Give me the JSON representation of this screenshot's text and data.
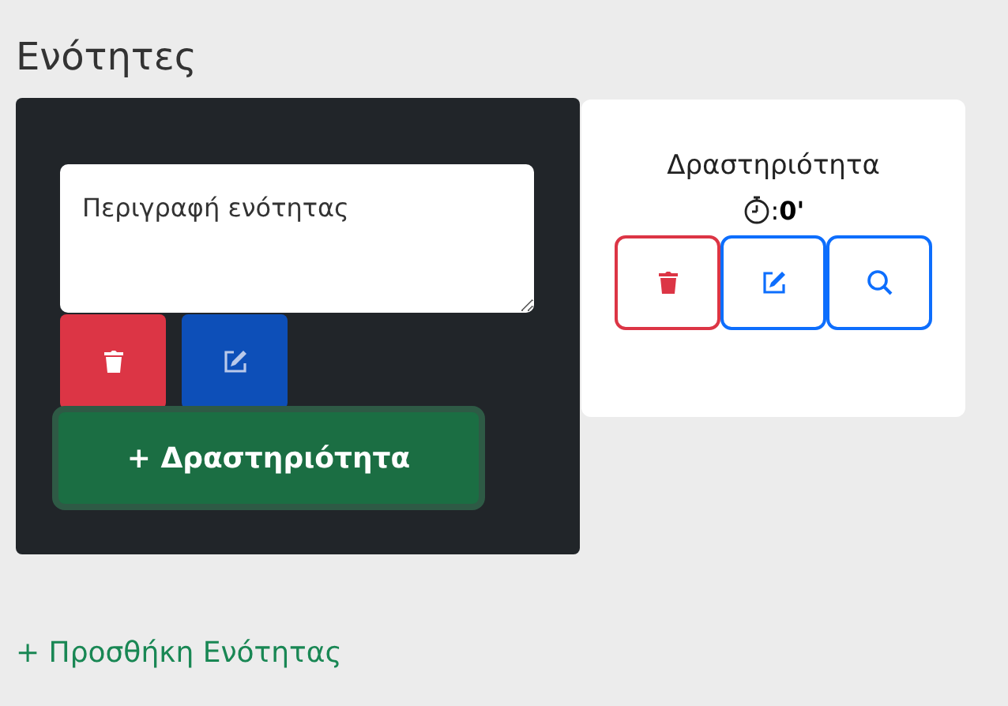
{
  "heading": "Ενότητες",
  "section": {
    "placeholder": "Περιγραφή ενότητας",
    "add_activity_button": "+ Δραστηριότητα"
  },
  "activities": [
    {
      "title": "Δραστηριότητα",
      "duration": ":**0'**"
    }
  ],
  "add_section_link": "+ Προσθήκη Ενότητας"
}
